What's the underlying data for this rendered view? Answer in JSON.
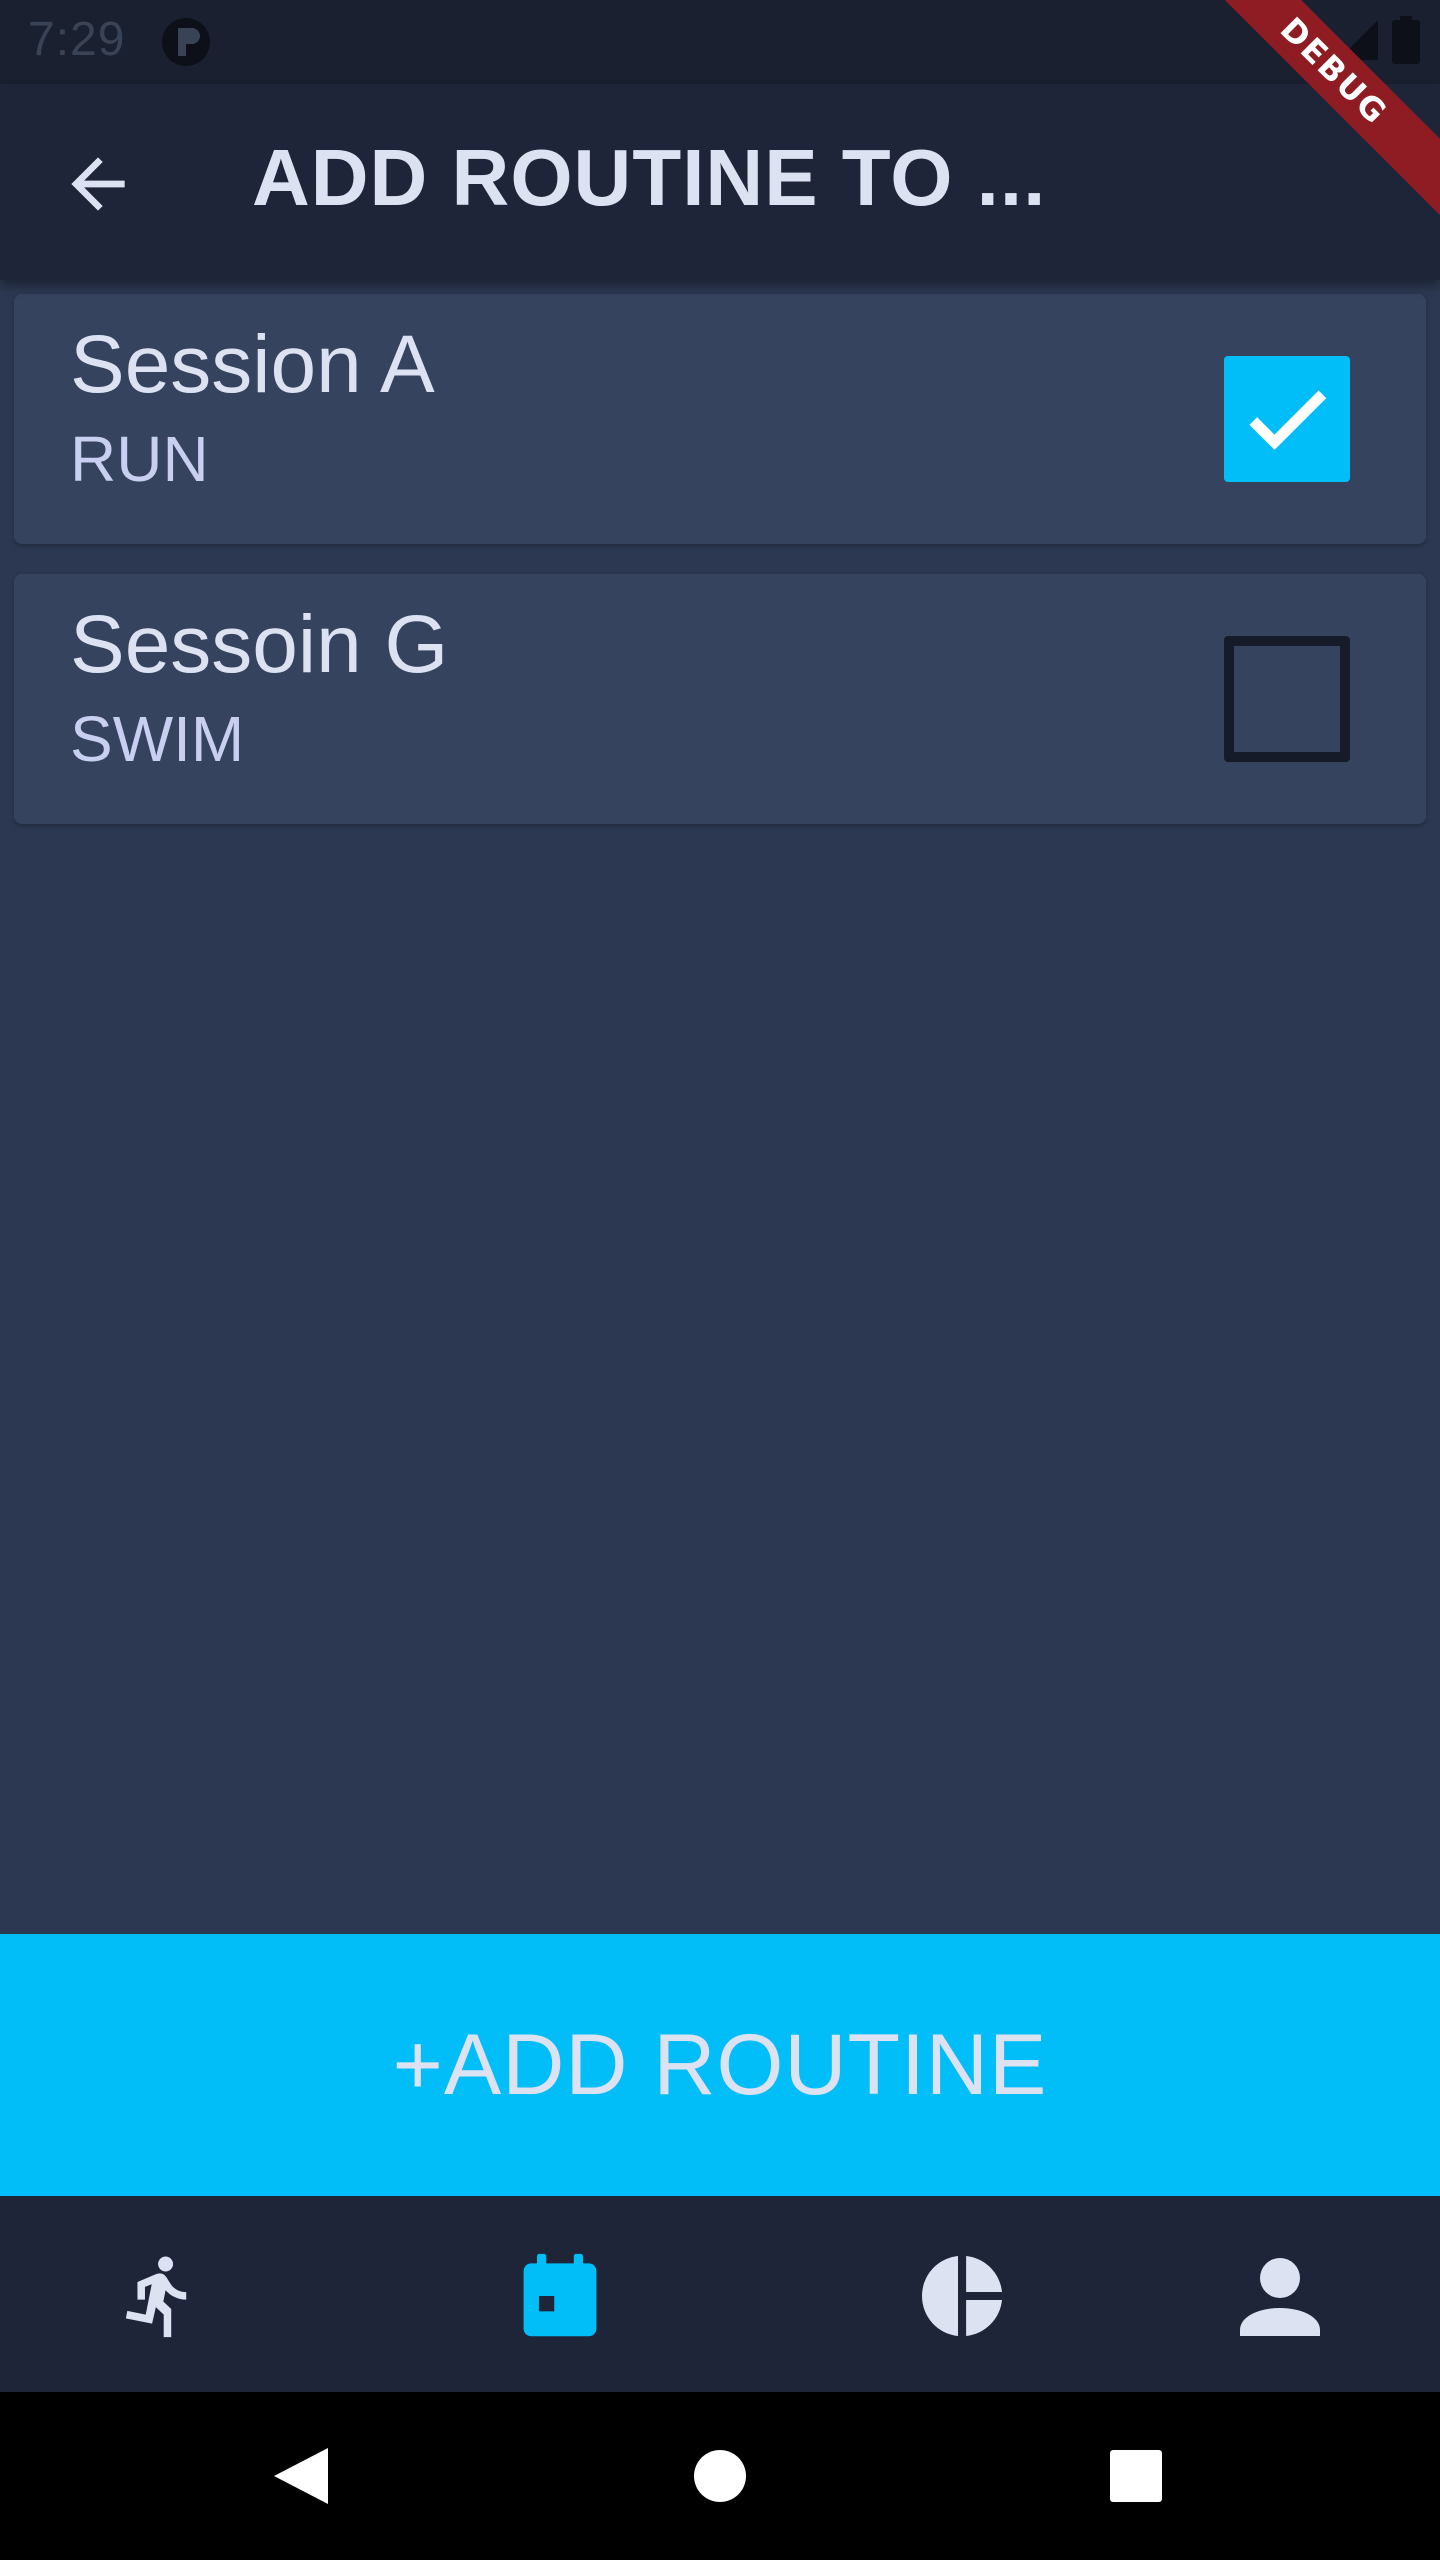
{
  "status_bar": {
    "time": "7:29"
  },
  "debug_banner": "DEBUG",
  "app_bar": {
    "title": "ADD ROUTINE TO ..."
  },
  "routines": [
    {
      "name": "Session A",
      "type": "RUN",
      "checked": true
    },
    {
      "name": "Sessoin G",
      "type": "SWIM",
      "checked": false
    }
  ],
  "add_button": {
    "label": "+ADD ROUTINE"
  },
  "bottom_nav": {
    "items": [
      {
        "icon": "running-icon",
        "active": false
      },
      {
        "icon": "calendar-icon",
        "active": true
      },
      {
        "icon": "pie-chart-icon",
        "active": false
      },
      {
        "icon": "person-icon",
        "active": false
      }
    ]
  },
  "colors": {
    "background": "#2c3852",
    "app_bar": "#1e2538",
    "card": "#35435e",
    "accent": "#02bef8",
    "text": "#dde2f2",
    "debug": "#8e1c22"
  }
}
